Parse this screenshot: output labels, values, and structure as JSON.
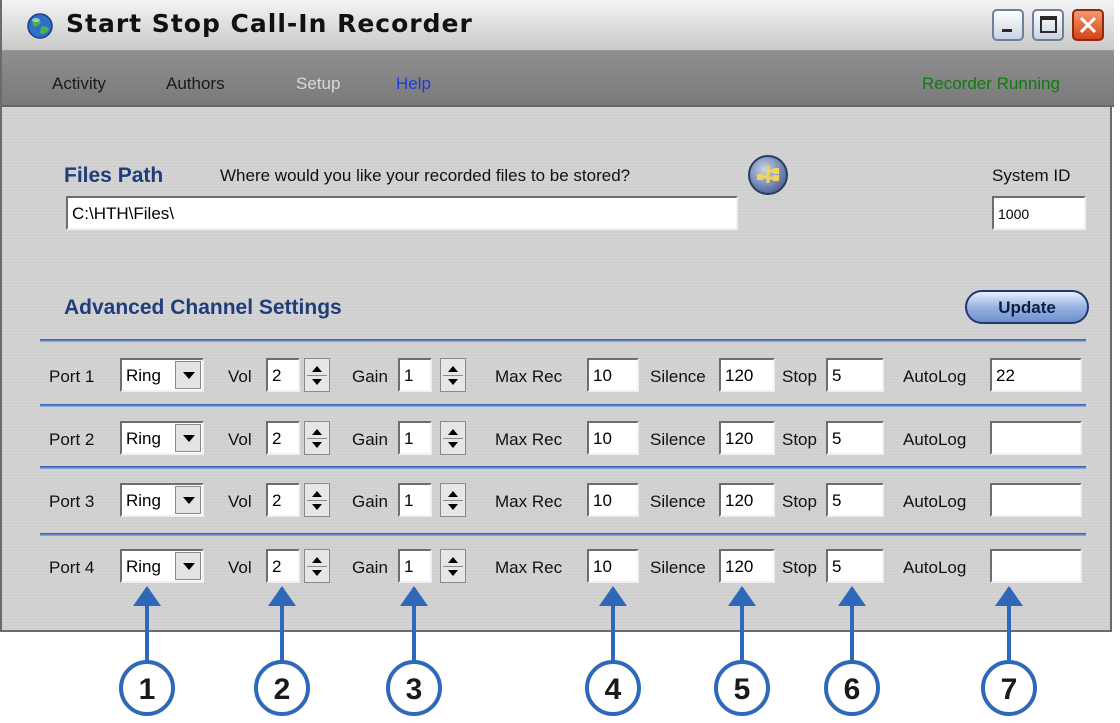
{
  "window": {
    "title": "Start Stop Call-In Recorder"
  },
  "menu": {
    "activity": "Activity",
    "authors": "Authors",
    "setup": "Setup",
    "help": "Help"
  },
  "status": "Recorder Running",
  "files_path": {
    "title": "Files Path",
    "question": "Where would you like your recorded files to be stored?",
    "value": "C:\\HTH\\Files\\"
  },
  "system_id": {
    "label": "System ID",
    "value": "1000"
  },
  "advanced": {
    "title": "Advanced Channel Settings",
    "update_label": "Update"
  },
  "channel_labels": {
    "vol": "Vol",
    "gain": "Gain",
    "max_rec": "Max Rec",
    "silence": "Silence",
    "stop": "Stop",
    "autolog": "AutoLog"
  },
  "ports": [
    {
      "label": "Port 1",
      "mode": "Ring",
      "vol": "2",
      "gain": "1",
      "max_rec": "10",
      "silence": "120",
      "stop": "5",
      "autolog": "22"
    },
    {
      "label": "Port 2",
      "mode": "Ring",
      "vol": "2",
      "gain": "1",
      "max_rec": "10",
      "silence": "120",
      "stop": "5",
      "autolog": ""
    },
    {
      "label": "Port 3",
      "mode": "Ring",
      "vol": "2",
      "gain": "1",
      "max_rec": "10",
      "silence": "120",
      "stop": "5",
      "autolog": ""
    },
    {
      "label": "Port 4",
      "mode": "Ring",
      "vol": "2",
      "gain": "1",
      "max_rec": "10",
      "silence": "120",
      "stop": "5",
      "autolog": ""
    }
  ],
  "callouts": [
    "1",
    "2",
    "3",
    "4",
    "5",
    "6",
    "7"
  ],
  "colors": {
    "heading": "#1f3d7a",
    "status": "#0f7a0f",
    "help": "#1e3cd8",
    "arrow": "#2e68b8"
  }
}
